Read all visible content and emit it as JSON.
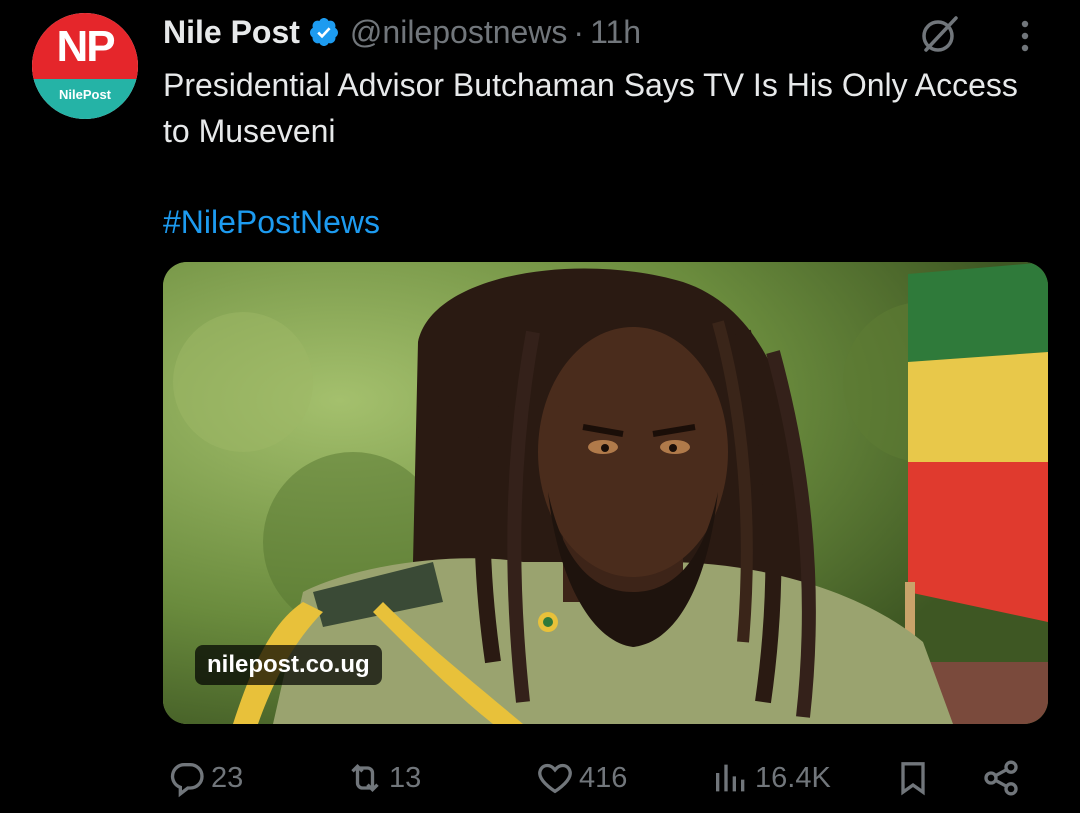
{
  "account": {
    "name": "Nile Post",
    "handle": "@nilepostnews",
    "separator": "·",
    "time": "11h",
    "avatar_logo": "NP",
    "avatar_brand": "NilePost"
  },
  "post": {
    "text": "Presidential Advisor Butchaman Says TV Is His Only Access to Museveni",
    "hashtag": "#NilePostNews"
  },
  "media": {
    "domain": "nilepost.co.ug",
    "alt": "photo"
  },
  "actions": {
    "replies": "23",
    "reposts": "13",
    "likes": "416",
    "views": "16.4K"
  },
  "icons": {
    "verified": "verified-badge-icon",
    "grok": "grok-icon",
    "more": "more-icon",
    "reply": "reply-icon",
    "repost": "repost-icon",
    "like": "heart-icon",
    "views": "views-icon",
    "bookmark": "bookmark-icon",
    "share": "share-icon"
  },
  "colors": {
    "background": "#000000",
    "text": "#e7e9ea",
    "muted": "#71767b",
    "link": "#1d9bf0",
    "verified": "#1d9bf0",
    "logo_red": "#e5262b",
    "logo_teal": "#25b3a6"
  }
}
